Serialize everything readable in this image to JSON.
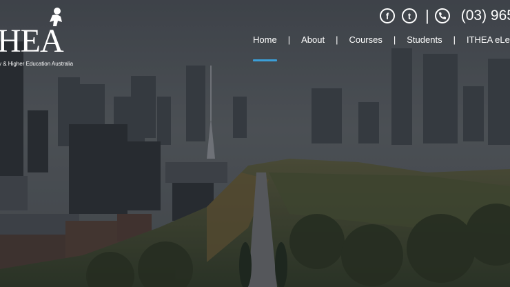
{
  "brand": {
    "name": "ITHEA",
    "logo_text": "HEA",
    "tagline": "y & Higher Education Australia"
  },
  "header": {
    "phone": "(03) 965",
    "social": [
      {
        "name": "facebook-icon",
        "glyph": "f"
      },
      {
        "name": "twitter-icon",
        "glyph": "t"
      }
    ]
  },
  "nav": {
    "items": [
      "Home",
      "About",
      "Courses",
      "Students",
      "ITHEA eLearning"
    ],
    "active": "Home",
    "separator": "|"
  },
  "colors": {
    "accent": "#3b9fd8",
    "overlay": "#2f3438"
  }
}
